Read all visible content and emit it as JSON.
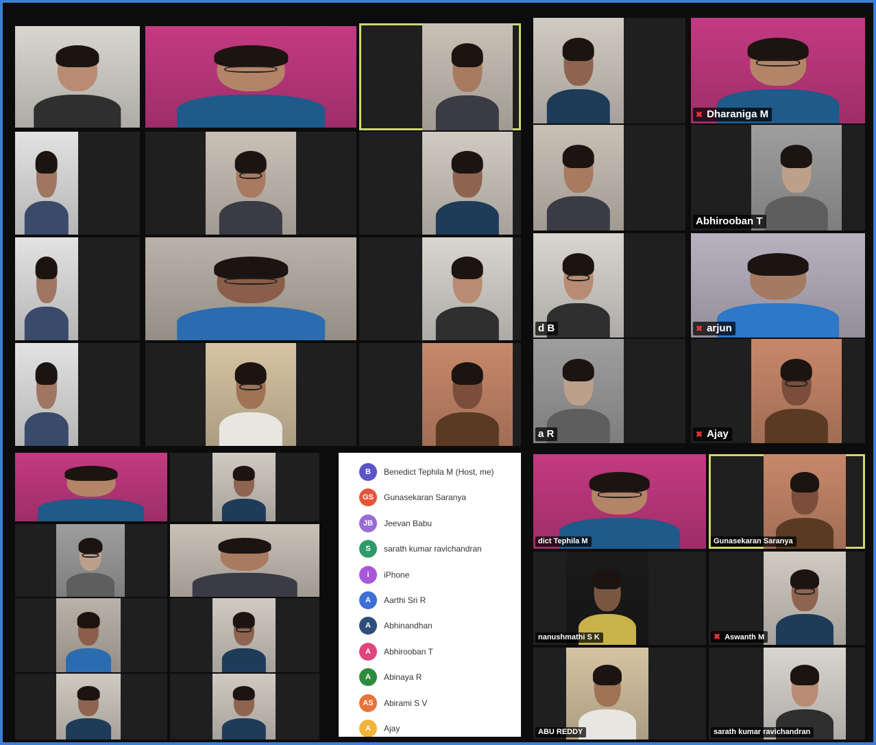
{
  "name_tags": {
    "dharaniga": "Dharaniga M",
    "abhirooban": "Abhirooban T",
    "b_partial": "d B",
    "arjun": "arjun",
    "r_partial": "a R",
    "ajay": "Ajay",
    "benedict_partial": "dict Tephila M",
    "gunasekaran": "Gunasekaran Saranya",
    "anushmathi_partial": "nanushmathi S K",
    "aswanth": "Aswanth M",
    "reddy_partial": "ABU REDDY",
    "sarath": "sarath kumar ravichandran"
  },
  "participants_panel": {
    "items": [
      {
        "initials": "B",
        "name": "Benedict Tephila M (Host, me)",
        "color": "#5b55c9"
      },
      {
        "initials": "GS",
        "name": "Gunasekaran Saranya",
        "color": "#e2573a"
      },
      {
        "initials": "JB",
        "name": "Jeevan Babu",
        "color": "#9a6bd6"
      },
      {
        "initials": "S",
        "name": "sarath kumar ravichandran",
        "color": "#2e9a6a"
      },
      {
        "initials": "i",
        "name": "iPhone",
        "color": "#a857d8"
      },
      {
        "initials": "A",
        "name": "Aarthi Sri R",
        "color": "#3d6fd6"
      },
      {
        "initials": "A",
        "name": "Abhinandhan",
        "color": "#2f4f7a"
      },
      {
        "initials": "A",
        "name": "Abhirooban T",
        "color": "#e0457b"
      },
      {
        "initials": "A",
        "name": "Abinaya R",
        "color": "#2f8a3e"
      },
      {
        "initials": "AS",
        "name": "Abirami S V",
        "color": "#e6743a"
      },
      {
        "initials": "A",
        "name": "Ajay",
        "color": "#f0b43a"
      }
    ]
  },
  "colors": {
    "frame_border": "#3b7fd4",
    "active_speaker": "#cfd86a",
    "muted_icon": "#e8353a"
  }
}
